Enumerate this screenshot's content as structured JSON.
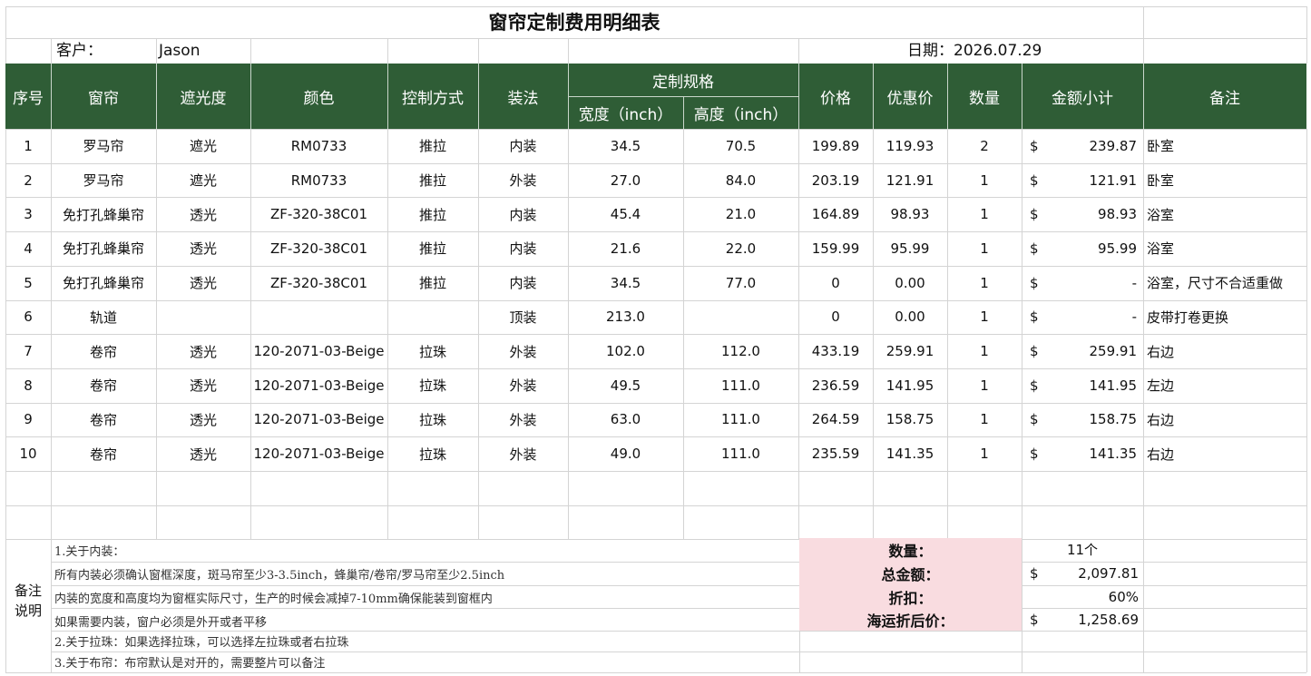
{
  "title": "窗帘定制费用明细表",
  "info": {
    "customer_label": "客户：",
    "customer_name": "Jason",
    "date_label": "日期：",
    "date_value": "2026.07.29"
  },
  "headers": {
    "index": "序号",
    "curtain": "窗帘",
    "shading": "遮光度",
    "color": "颜色",
    "control": "控制方式",
    "install": "装法",
    "spec": "定制规格",
    "width": "宽度（inch）",
    "height": "高度（inch）",
    "price": "价格",
    "discount_price": "优惠价",
    "qty": "数量",
    "subtotal": "金额小计",
    "remark": "备注"
  },
  "currency_symbol": "$",
  "rows": [
    {
      "index": "1",
      "curtain": "罗马帘",
      "shading": "遮光",
      "color": "RM0733",
      "control": "推拉",
      "install": "内装",
      "width": "34.5",
      "height": "70.5",
      "price": "199.89",
      "discount_price": "119.93",
      "qty": "2",
      "subtotal": "239.87",
      "remark": "卧室"
    },
    {
      "index": "2",
      "curtain": "罗马帘",
      "shading": "遮光",
      "color": "RM0733",
      "control": "推拉",
      "install": "外装",
      "width": "27.0",
      "height": "84.0",
      "price": "203.19",
      "discount_price": "121.91",
      "qty": "1",
      "subtotal": "121.91",
      "remark": "卧室"
    },
    {
      "index": "3",
      "curtain": "免打孔蜂巢帘",
      "shading": "透光",
      "color": "ZF-320-38C01",
      "control": "推拉",
      "install": "内装",
      "width": "45.4",
      "height": "21.0",
      "price": "164.89",
      "discount_price": "98.93",
      "qty": "1",
      "subtotal": "98.93",
      "remark": "浴室"
    },
    {
      "index": "4",
      "curtain": "免打孔蜂巢帘",
      "shading": "透光",
      "color": "ZF-320-38C01",
      "control": "推拉",
      "install": "内装",
      "width": "21.6",
      "height": "22.0",
      "price": "159.99",
      "discount_price": "95.99",
      "qty": "1",
      "subtotal": "95.99",
      "remark": "浴室"
    },
    {
      "index": "5",
      "curtain": "免打孔蜂巢帘",
      "shading": "透光",
      "color": "ZF-320-38C01",
      "control": "推拉",
      "install": "内装",
      "width": "34.5",
      "height": "77.0",
      "price": "0",
      "discount_price": "0.00",
      "qty": "1",
      "subtotal": "-",
      "remark": "浴室，尺寸不合适重做"
    },
    {
      "index": "6",
      "curtain": "轨道",
      "shading": "",
      "color": "",
      "control": "",
      "install": "顶装",
      "width": "213.0",
      "height": "",
      "price": "0",
      "discount_price": "0.00",
      "qty": "1",
      "subtotal": "-",
      "remark": "皮带打卷更换"
    },
    {
      "index": "7",
      "curtain": "卷帘",
      "shading": "透光",
      "color": "120-2071-03-Beige",
      "control": "拉珠",
      "install": "外装",
      "width": "102.0",
      "height": "112.0",
      "price": "433.19",
      "discount_price": "259.91",
      "qty": "1",
      "subtotal": "259.91",
      "remark": "右边"
    },
    {
      "index": "8",
      "curtain": "卷帘",
      "shading": "透光",
      "color": "120-2071-03-Beige",
      "control": "拉珠",
      "install": "外装",
      "width": "49.5",
      "height": "111.0",
      "price": "236.59",
      "discount_price": "141.95",
      "qty": "1",
      "subtotal": "141.95",
      "remark": "左边"
    },
    {
      "index": "9",
      "curtain": "卷帘",
      "shading": "透光",
      "color": "120-2071-03-Beige",
      "control": "拉珠",
      "install": "外装",
      "width": "63.0",
      "height": "111.0",
      "price": "264.59",
      "discount_price": "158.75",
      "qty": "1",
      "subtotal": "158.75",
      "remark": "右边"
    },
    {
      "index": "10",
      "curtain": "卷帘",
      "shading": "透光",
      "color": "120-2071-03-Beige",
      "control": "拉珠",
      "install": "外装",
      "width": "49.0",
      "height": "111.0",
      "price": "235.59",
      "discount_price": "141.35",
      "qty": "1",
      "subtotal": "141.35",
      "remark": "右边"
    }
  ],
  "remarks": {
    "label_line1": "备注",
    "label_line2": "说明",
    "lines": [
      "1.关于内装：",
      "所有内装必须确认窗框深度，斑马帘至少3-3.5inch，蜂巢帘/卷帘/罗马帘至少2.5inch",
      "内装的宽度和高度均为窗框实际尺寸，生产的时候会减掉7-10mm确保能装到窗框内",
      "如果需要内装，窗户必须是外开或者平移",
      "2.关于拉珠：如果选择拉珠，可以选择左拉珠或者右拉珠",
      "3.关于布帘：布帘默认是对开的，需要整片可以备注"
    ]
  },
  "summary": {
    "qty_label": "数量：",
    "qty_value": "11个",
    "total_label": "总金额：",
    "total_value": "2,097.81",
    "discount_label": "折扣：",
    "discount_value": "60%",
    "final_label": "海运折后价：",
    "final_value": "1,258.69"
  }
}
